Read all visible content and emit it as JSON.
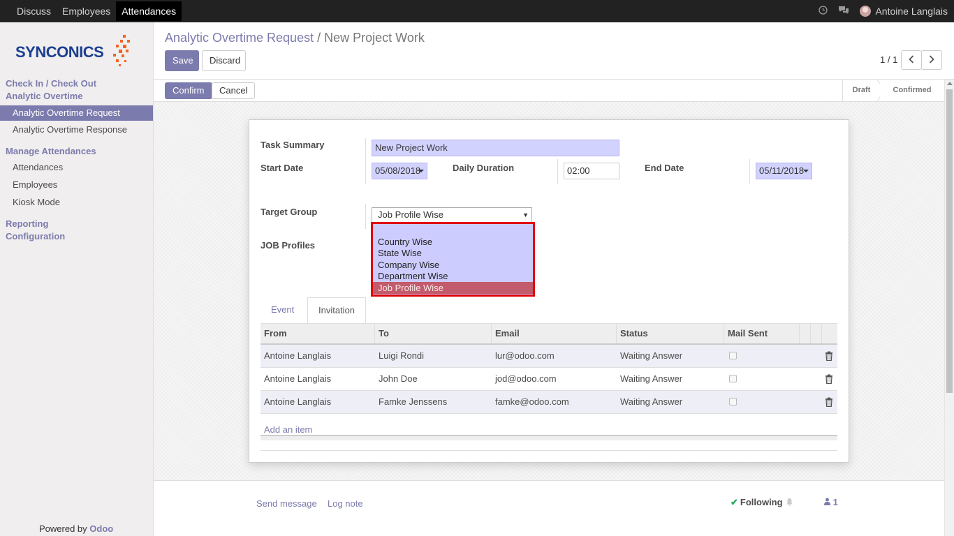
{
  "topbar": {
    "menu": [
      "Discuss",
      "Employees",
      "Attendances"
    ],
    "active_menu": "Attendances",
    "clock_icon": "clock-icon",
    "chat_icon": "chat-icon",
    "user_name": "Antoine Langlais"
  },
  "sidebar": {
    "logo_text": "SYNCONICS",
    "sections": [
      {
        "title": "Check In / Check Out"
      },
      {
        "title": "Analytic Overtime"
      }
    ],
    "overtime_items": [
      "Analytic Overtime Request",
      "Analytic Overtime Response"
    ],
    "manage_title": "Manage Attendances",
    "manage_items": [
      "Attendances",
      "Employees",
      "Kiosk Mode"
    ],
    "reporting": "Reporting",
    "configuration": "Configuration",
    "powered_prefix": "Powered by",
    "powered_brand": "Odoo"
  },
  "control_panel": {
    "breadcrumb_parent": "Analytic Overtime Request",
    "breadcrumb_sep": "/",
    "breadcrumb_current": "New Project Work",
    "save_label": "Save",
    "discard_label": "Discard",
    "pager": "1 / 1"
  },
  "statusbar": {
    "confirm_label": "Confirm",
    "cancel_label": "Cancel",
    "stages": [
      "Draft",
      "Confirmed"
    ]
  },
  "form": {
    "task_summary_label": "Task Summary",
    "task_summary_value": "New Project Work",
    "start_date_label": "Start Date",
    "start_date_value": "05/08/2018",
    "daily_duration_label": "Daily Duration",
    "daily_duration_value": "02:00",
    "end_date_label": "End Date",
    "end_date_value": "05/11/2018",
    "target_group_label": "Target Group",
    "target_group_value": "Job Profile Wise",
    "target_group_options": [
      "",
      "Country Wise",
      "State Wise",
      "Company Wise",
      "Department Wise",
      "Job Profile Wise"
    ],
    "job_profiles_label": "JOB Profiles"
  },
  "tabs": [
    "Event",
    "Invitation Detail"
  ],
  "active_tab": "Invitation Detail",
  "table": {
    "columns": [
      "From",
      "To",
      "Email",
      "Status",
      "Mail Sent"
    ],
    "rows": [
      {
        "from": "Antoine Langlais",
        "to": "Luigi Rondi",
        "email": "lur@odoo.com",
        "status": "Waiting Answer",
        "mail_sent": false
      },
      {
        "from": "Antoine Langlais",
        "to": "John Doe",
        "email": "jod@odoo.com",
        "status": "Waiting Answer",
        "mail_sent": false
      },
      {
        "from": "Antoine Langlais",
        "to": "Famke Jenssens",
        "email": "famke@odoo.com",
        "status": "Waiting Answer",
        "mail_sent": false
      }
    ],
    "add_item": "Add an item"
  },
  "chatter": {
    "send_message": "Send message",
    "log_note": "Log note",
    "following": "Following",
    "followers_count": "1"
  },
  "colors": {
    "accent": "#7c7bad",
    "required_bg": "#d2d2ff",
    "dropdown_bg": "#ccccff",
    "dropdown_selected": "#c25b6b",
    "highlight_border": "#e00000"
  }
}
